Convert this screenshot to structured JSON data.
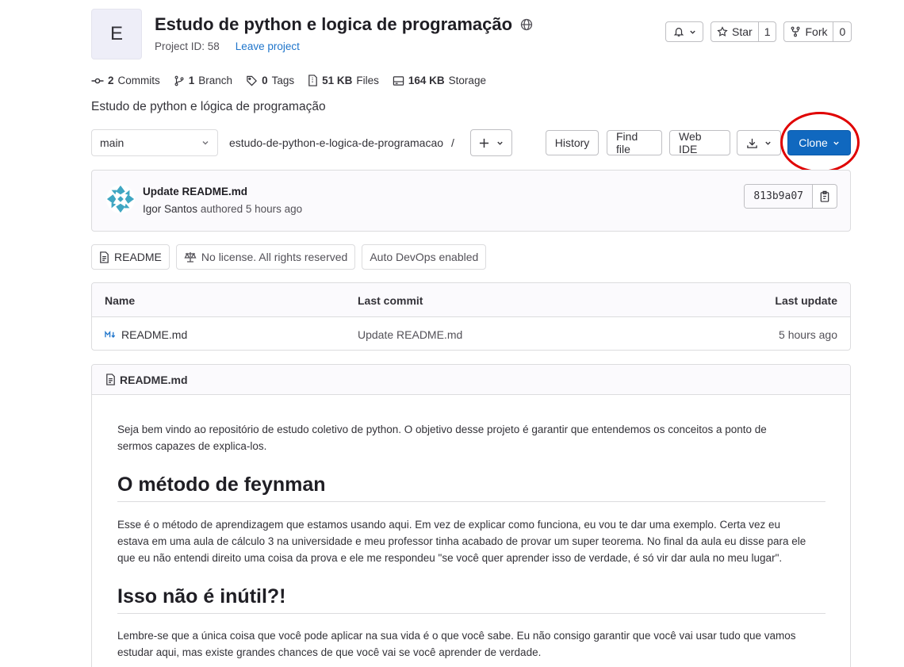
{
  "project": {
    "avatar_letter": "E",
    "title": "Estudo de python e logica de programação",
    "id_label": "Project ID: 58",
    "leave_label": "Leave project",
    "description": "Estudo de python e lógica de programação"
  },
  "header_buttons": {
    "star_label": "Star",
    "star_count": "1",
    "fork_label": "Fork",
    "fork_count": "0"
  },
  "stats": {
    "commits_count": "2",
    "commits_label": "Commits",
    "branch_count": "1",
    "branch_label": "Branch",
    "tags_count": "0",
    "tags_label": "Tags",
    "files_size": "51 KB",
    "files_label": "Files",
    "storage_size": "164 KB",
    "storage_label": "Storage"
  },
  "toolbar": {
    "branch": "main",
    "path": "estudo-de-python-e-logica-de-programacao",
    "path_sep": "/",
    "history_label": "History",
    "find_file_label": "Find file",
    "web_ide_label": "Web IDE",
    "clone_label": "Clone"
  },
  "commit": {
    "title": "Update README.md",
    "author": "Igor Santos",
    "meta": "authored 5 hours ago",
    "sha": "813b9a07"
  },
  "badges": {
    "readme": "README",
    "license": "No license. All rights reserved",
    "devops": "Auto DevOps enabled"
  },
  "file_table": {
    "headers": {
      "name": "Name",
      "last_commit": "Last commit",
      "last_update": "Last update"
    },
    "rows": [
      {
        "name": "README.md",
        "last_commit": "Update README.md",
        "last_update": "5 hours ago"
      }
    ]
  },
  "readme": {
    "filename": "README.md",
    "intro_line1": "Seja bem vindo ao repositório de estudo coletivo de python. O objetivo desse projeto é garantir que entendemos os conceitos a ponto de",
    "intro_line2": "sermos capazes de explica-los.",
    "h1": "O método de feynman",
    "p1_line1": "Esse é o método de aprendizagem que estamos usando aqui. Em vez de explicar como funciona, eu vou te dar uma exemplo. Certa vez eu",
    "p1_line2": "estava em uma aula de cálculo 3 na universidade e meu professor tinha acabado de provar um super teorema. No final da aula eu disse para ele",
    "p1_line3": "que eu não entendi direito uma coisa da prova e ele me respondeu \"se você quer aprender isso de verdade, é só vir dar aula no meu lugar\".",
    "h2": "Isso não é inútil?!",
    "p2_line1": "Lembre-se que a única coisa que você pode aplicar na sua vida é o que você sabe. Eu não consigo garantir que você vai usar tudo que vamos",
    "p2_line2": "estudar aqui, mas existe grandes chances de que você vai se você aprender de verdade."
  },
  "colors": {
    "clone_button": "#1068bf",
    "link": "#1f75cb",
    "highlight_ring": "#e00000"
  }
}
